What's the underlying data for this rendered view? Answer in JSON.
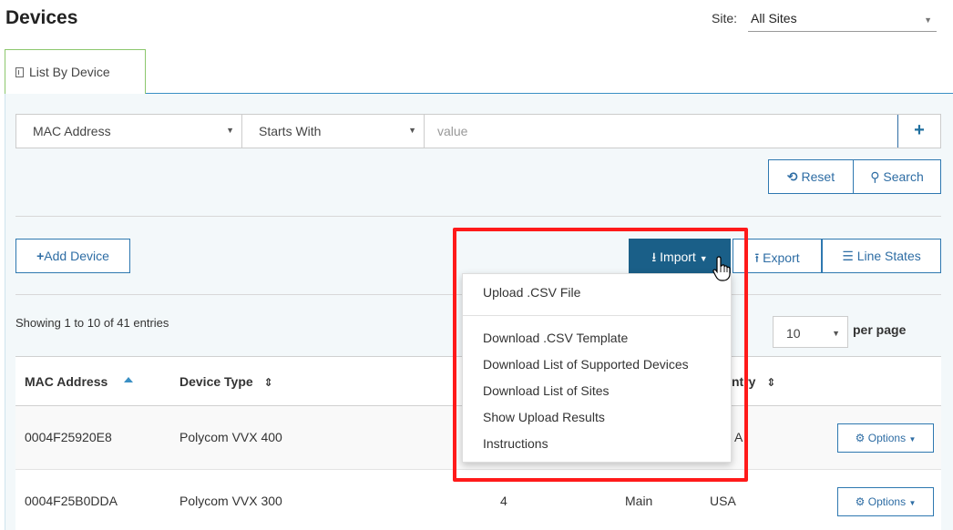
{
  "header": {
    "title": "Devices",
    "site_label": "Site:",
    "site_value": "All Sites"
  },
  "tabs": [
    {
      "label": "List By Device"
    }
  ],
  "filter": {
    "field": "MAC Address",
    "operator": "Starts With",
    "value_placeholder": "value",
    "add_label": "+"
  },
  "buttons": {
    "reset": "Reset",
    "search": "Search",
    "add_device": "Add Device",
    "import": "Import",
    "export": "Export",
    "line_states": "Line States",
    "options": "Options"
  },
  "import_menu": {
    "items": [
      "Upload .CSV File",
      "Download .CSV Template",
      "Download List of Supported Devices",
      "Download List of Sites",
      "Show Upload Results",
      "Instructions"
    ]
  },
  "list": {
    "showing": "Showing 1 to 10 of 41 entries",
    "per_page_value": "10",
    "per_page_label": "per page"
  },
  "table": {
    "columns": [
      "MAC Address",
      "Device Type",
      "ntry"
    ],
    "rows": [
      {
        "mac": "0004F25920E8",
        "type": "Polycom VVX 400",
        "col3": "",
        "site": "",
        "country": "A"
      },
      {
        "mac": "0004F25B0DDA",
        "type": "Polycom VVX 300",
        "col3": "4",
        "site": "Main",
        "country": "USA"
      }
    ]
  },
  "colors": {
    "accent": "#1a5f88",
    "link": "#2e6da4",
    "tab_border": "#8cc76d",
    "highlight": "#ff1a1a"
  }
}
